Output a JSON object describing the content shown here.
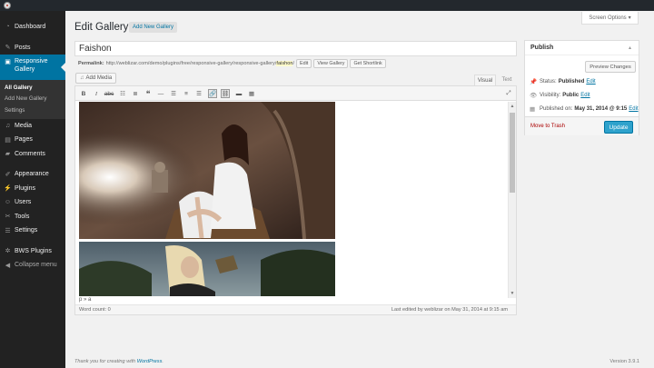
{
  "sidebar": {
    "items": [
      {
        "label": "Dashboard",
        "icon": "dashboard-icon"
      },
      {
        "label": "Posts",
        "icon": "pin-icon"
      },
      {
        "label": "Responsive Gallery",
        "icon": "gallery-icon"
      },
      {
        "label": "Media",
        "icon": "media-icon"
      },
      {
        "label": "Pages",
        "icon": "pages-icon"
      },
      {
        "label": "Comments",
        "icon": "comments-icon"
      },
      {
        "label": "Appearance",
        "icon": "brush-icon"
      },
      {
        "label": "Plugins",
        "icon": "plug-icon"
      },
      {
        "label": "Users",
        "icon": "user-icon"
      },
      {
        "label": "Tools",
        "icon": "wrench-icon"
      },
      {
        "label": "Settings",
        "icon": "settings-icon"
      },
      {
        "label": "BWS Plugins",
        "icon": "gear-icon"
      },
      {
        "label": "Collapse menu",
        "icon": "collapse-icon"
      }
    ],
    "submenu": [
      "All Gallery",
      "Add New Gallery",
      "Settings"
    ]
  },
  "screen_options": "Screen Options",
  "header": {
    "title": "Edit Gallery",
    "add_new": "Add New Gallery"
  },
  "post": {
    "title": "Faishon",
    "permalink_label": "Permalink:",
    "permalink_base": "http://weblizar.com/demo/plugins/free/responsive-gallery/responsive-gallery/",
    "permalink_slug": "faishon",
    "permalink_end": "/",
    "edit_btn": "Edit",
    "view_btn": "View Gallery",
    "shortlink_btn": "Get Shortlink"
  },
  "editor": {
    "add_media": "Add Media",
    "tab_visual": "Visual",
    "tab_text": "Text",
    "path": "p » a",
    "word_count": "Word count: 0",
    "last_edited": "Last edited by weblizar on May 31, 2014 at 9:15 am"
  },
  "publish": {
    "title": "Publish",
    "preview_btn": "Preview Changes",
    "status_label": "Status:",
    "status_value": "Published",
    "visibility_label": "Visibility:",
    "visibility_value": "Public",
    "published_label": "Published on:",
    "published_value": "May 31, 2014 @ 9:15",
    "edit_link": "Edit",
    "trash": "Move to Trash",
    "update_btn": "Update"
  },
  "footer": {
    "thanks_prefix": "Thank you for creating with ",
    "thanks_link": "WordPress",
    "thanks_suffix": ".",
    "version": "Version 3.9.1"
  }
}
